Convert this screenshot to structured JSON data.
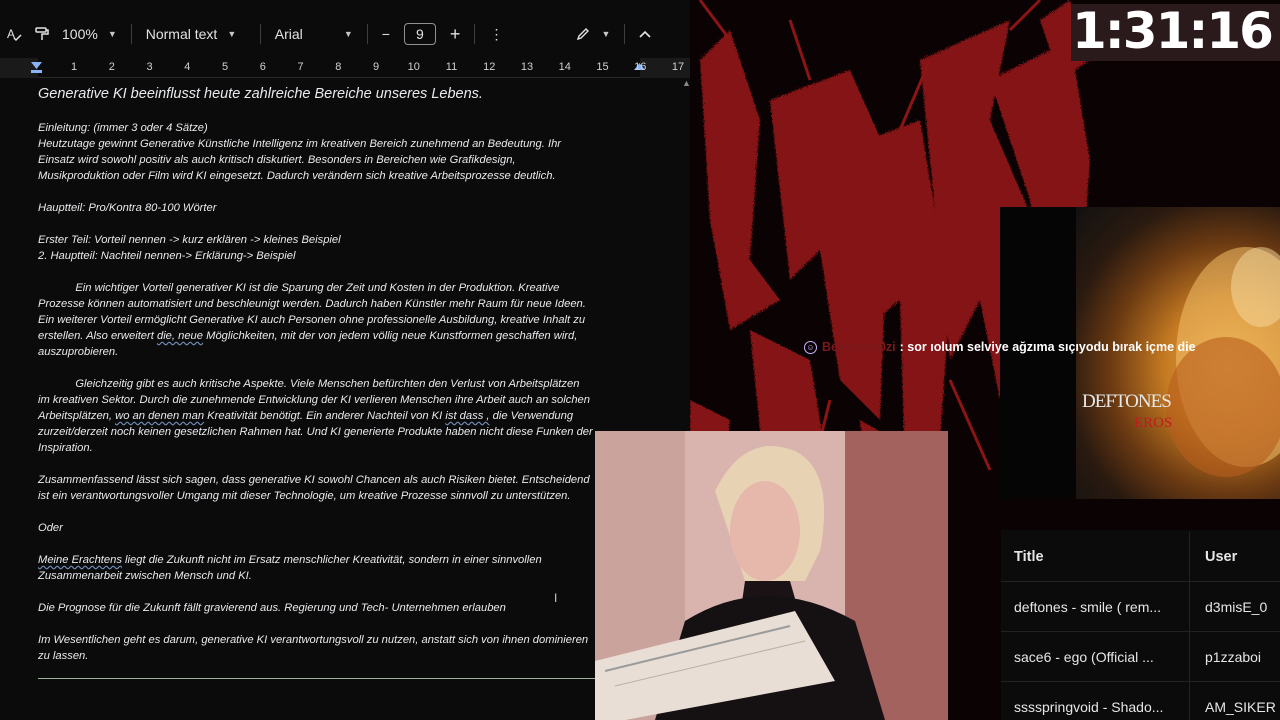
{
  "editor": {
    "toolbar": {
      "zoom": "100%",
      "style": "Normal text",
      "font": "Arial",
      "font_size": "9",
      "minus": "−",
      "plus": "+"
    },
    "ruler_numbers": [
      "1",
      "2",
      "3",
      "4",
      "5",
      "6",
      "7",
      "8",
      "9",
      "10",
      "11",
      "12",
      "13",
      "14",
      "15",
      "16",
      "17"
    ],
    "document": {
      "heading": "Generative KI beeinflusst heute zahlreiche Bereiche unseres Lebens.",
      "intro_label": "Einleitung: (immer 3 oder 4 Sätze)",
      "intro_text": "Heutzutage gewinnt Generative Künstliche Intelligenz im kreativen Bereich zunehmend an Bedeutung. Ihr\nEinsatz wird sowohl positiv als auch kritisch diskutiert. Besonders in Bereichen wie Grafikdesign,\nMusikproduktion oder Film wird KI eingesetzt. Dadurch verändern sich kreative Arbeitsprozesse deutlich.",
      "main_label": "Hauptteil: Pro/Kontra 80-100 Wörter",
      "first_part": "Erster Teil: Vorteil nennen -> kurz erklären -> kleines Beispiel",
      "second_part": "2. Hauptteil: Nachteil nennen-> Erklärung-> Beispiel",
      "para1_a": "            Ein wichtiger Vorteil generativer KI ist die Sparung der Zeit und Kosten in der Produktion. Kreative\nProzesse können automatisiert und beschleunigt werden. Dadurch haben Künstler mehr Raum für neue Ideen.\nEin weiterer Vorteil ermöglicht Generative KI auch Personen ohne professionelle Ausbildung, kreative Inhalt zu\nerstellen. Also erweitert ",
      "para1_squig": "die, neue",
      "para1_b": " Möglichkeiten, mit der von jedem völlig neue Kunstformen geschaffen wird,\nauszuprobieren.",
      "para2_a": "            Gleichzeitig gibt es auch kritische Aspekte. Viele Menschen befürchten den Verlust von Arbeitsplätzen\nim kreativen Sektor. Durch die zunehmende Entwicklung der KI verlieren Menschen ihre Arbeit auch an solchen\nArbeitsplätzen, ",
      "para2_squig1": "wo an denen man",
      "para2_b": " Kreativität benötigt. Ein anderer Nachteil von KI ",
      "para2_squig2": "ist dass ,",
      "para2_c": " die Verwendung\nzurzeit/derzeit noch keinen gesetzlichen Rahmen hat. Und KI generierte Produkte haben nicht diese Funken der\nInspiration.",
      "conclusion": "Zusammenfassend lässt sich sagen, dass generative KI sowohl Chancen als auch Risiken bietet. Entscheidend\nist ein verantwortungsvoller Umgang mit dieser Technologie, um kreative Prozesse sinnvoll zu unterstützen.",
      "oder": "Oder",
      "erachtens_squig": "Meine Erachtens",
      "erachtens_text": " liegt die Zukunft nicht im Ersatz menschlicher Kreativität, sondern in einer sinnvollen\nZusammenarbeit zwischen Mensch und KI.",
      "prognose": "Die Prognose für die Zukunft fällt gravierend aus. Regierung und Tech- Unternehmen erlauben",
      "wesentlichen": "Im Wesentlichen geht es darum, generative KI verantwortungsvoll zu nutzen, anstatt sich von ihnen dominieren\nzu lassen."
    }
  },
  "stream": {
    "timer": "1:31:16",
    "chat": {
      "user": "Bey0nder0zi",
      "message": ": sor ıolum selviye ağzıma sıçıyodu bırak içme die"
    },
    "album": {
      "band": "DEFTONES",
      "title": "EROS"
    },
    "songs": {
      "headers": {
        "title": "Title",
        "user": "User"
      },
      "rows": [
        {
          "title": "deftones - smile ( rem...",
          "user": "d3misE_0"
        },
        {
          "title": "sace6 - ego (Official ...",
          "user": "p1zzaboi"
        },
        {
          "title": "sssspringvoid - Shado...",
          "user": "AM_SIKER"
        }
      ]
    }
  },
  "colors": {
    "logo_red": "#8b1414",
    "doc_bg": "#0b0b0c"
  }
}
